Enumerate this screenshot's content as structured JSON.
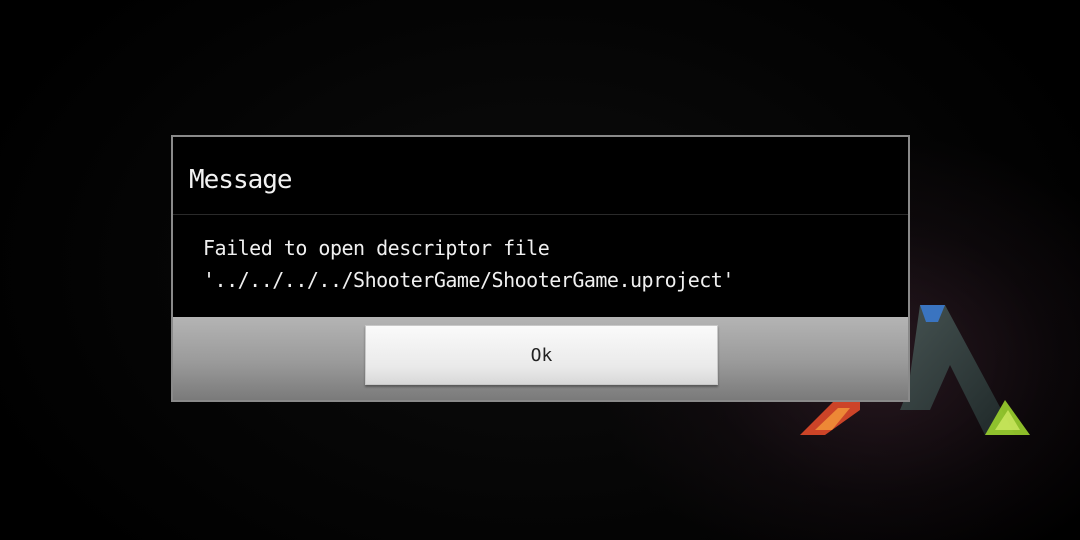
{
  "dialog": {
    "title": "Message",
    "message": "Failed to open descriptor file '../../../../ShooterGame/ShooterGame.uproject'",
    "ok_label": "Ok"
  },
  "background": {
    "logo_icon": "ark-logo-icon",
    "logo_colors": [
      "#e04a2a",
      "#3a7bd5",
      "#9bd12e",
      "#2e8f5a"
    ]
  }
}
